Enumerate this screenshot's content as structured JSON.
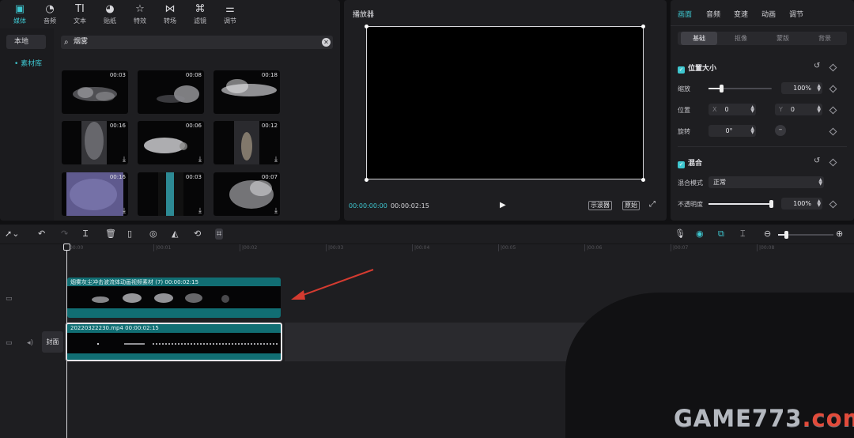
{
  "media": {
    "tabs": [
      {
        "label": "媒体",
        "icon": "media-icon"
      },
      {
        "label": "音频",
        "icon": "audio-icon"
      },
      {
        "label": "文本",
        "icon": "text-icon"
      },
      {
        "label": "贴纸",
        "icon": "sticker-icon"
      },
      {
        "label": "特效",
        "icon": "effects-icon"
      },
      {
        "label": "转场",
        "icon": "transition-icon"
      },
      {
        "label": "滤镜",
        "icon": "filter-icon"
      },
      {
        "label": "调节",
        "icon": "adjust-icon"
      }
    ],
    "side_local": "本地",
    "side_library": "• 素材库",
    "search_value": "烟雾",
    "thumbs": [
      {
        "duration": "00:03",
        "download": false
      },
      {
        "duration": "00:08",
        "download": false
      },
      {
        "duration": "00:18",
        "download": false
      },
      {
        "duration": "00:16",
        "download": true
      },
      {
        "duration": "00:06",
        "download": true
      },
      {
        "duration": "00:12",
        "download": true
      },
      {
        "duration": "00:16",
        "download": true
      },
      {
        "duration": "00:03",
        "download": true
      },
      {
        "duration": "00:07",
        "download": true
      }
    ]
  },
  "player": {
    "title": "播放器",
    "current_time": "00:00:00:00",
    "total_time": "00:00:02:15",
    "scope_label": "示波器",
    "original_label": "原始"
  },
  "props": {
    "tabs": [
      "画面",
      "音频",
      "变速",
      "动画",
      "调节"
    ],
    "subtabs": [
      "基础",
      "抠像",
      "蒙版",
      "背景"
    ],
    "section_position": "位置大小",
    "scale_label": "缩放",
    "scale_value": "100%",
    "position_label": "位置",
    "pos_x_prefix": "X",
    "pos_x": "0",
    "pos_y_prefix": "Y",
    "pos_y": "0",
    "rotate_label": "旋转",
    "rotate_value": "0°",
    "section_blend": "混合",
    "blend_mode_label": "混合模式",
    "blend_mode_value": "正常",
    "opacity_label": "不透明度",
    "opacity_value": "100%"
  },
  "timeline": {
    "ruler": [
      "00:00",
      "|00:01",
      "|00:02",
      "|00:03",
      "|00:04",
      "|00:05",
      "|00:06",
      "|00:07",
      "|00:08"
    ],
    "overlay_clip_label": "烟雾灰尘冲击波流体动画视频素材 (7)    00:00:02:15",
    "main_clip_label": "20220322230.mp4    00:00:02:15",
    "cover_label": "封面"
  },
  "watermark": {
    "text": "GAME773",
    "suffix": ".com"
  },
  "colors": {
    "accent": "#3ec7d0",
    "clip": "#116e73",
    "arrow": "#d43b30"
  }
}
